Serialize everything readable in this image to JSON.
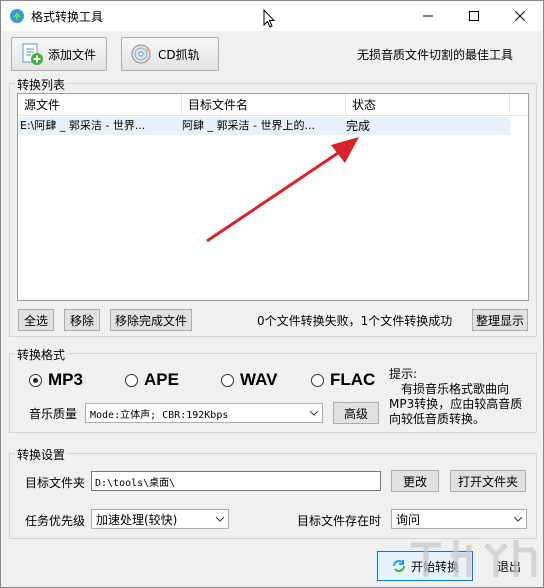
{
  "window": {
    "title": "格式转换工具"
  },
  "toolbar": {
    "add_file": "添加文件",
    "cd_rip": "CD抓轨",
    "slogan": "无损音质文件切割的最佳工具"
  },
  "list_group": {
    "title": "转换列表"
  },
  "list": {
    "columns": [
      "源文件",
      "目标文件名",
      "状态"
    ],
    "rows": [
      {
        "source": "E:\\阿肆 _ 郭采洁 - 世界...",
        "target": "阿肆 _ 郭采洁 - 世界上的...",
        "status": "完成"
      }
    ]
  },
  "list_buttons": {
    "select_all": "全选",
    "remove": "移除",
    "remove_done": "移除完成文件",
    "tidy": "整理显示"
  },
  "status_text": "0个文件转换失败，1个文件转换成功",
  "format_group": {
    "title": "转换格式",
    "formats": [
      "MP3",
      "APE",
      "WAV",
      "FLAC"
    ],
    "selected": "MP3",
    "quality_label": "音乐质量",
    "quality_value": "Mode:立体声; CBR:192Kbps",
    "advanced": "高级",
    "tip_title": "提示:",
    "tip_body": "有损音乐格式歌曲向MP3转换，应由较高音质向较低音质转换。"
  },
  "settings_group": {
    "title": "转换设置",
    "target_folder_label": "目标文件夹",
    "target_folder_value": "D:\\tools\\桌面\\",
    "change": "更改",
    "open_folder": "打开文件夹",
    "priority_label": "任务优先级",
    "priority_value": "加速处理(较快)",
    "exists_label": "目标文件存在时",
    "exists_value": "询问"
  },
  "footer": {
    "start": "开始转换",
    "exit": "退出"
  },
  "colors": {
    "arrow": "#d9232a",
    "selection": "#e8f0fb"
  }
}
